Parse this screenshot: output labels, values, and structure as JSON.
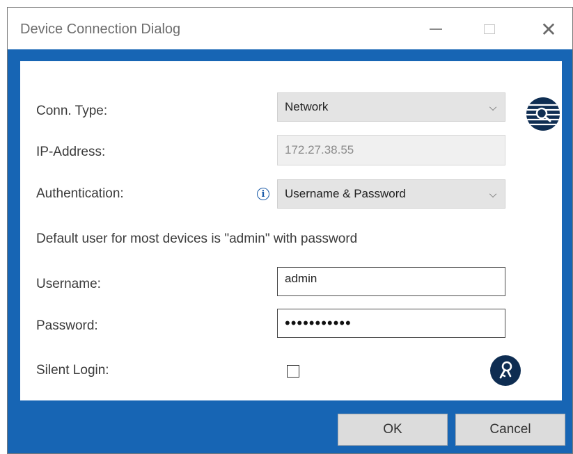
{
  "window": {
    "title": "Device Connection Dialog",
    "controls": {
      "close_glyph": "✕"
    }
  },
  "form": {
    "conn_type": {
      "label": "Conn. Type:",
      "value": "Network",
      "arrow": "⌵"
    },
    "ip_address": {
      "label": "IP-Address:",
      "value": "172.27.38.55"
    },
    "authentication": {
      "label": "Authentication:",
      "value": "Username & Password",
      "arrow": "⌵",
      "info_glyph": "i"
    },
    "note": "Default user for most devices is \"admin\" with password",
    "username": {
      "label": "Username:",
      "value": "admin"
    },
    "password": {
      "label": "Password:",
      "masked": "•••••••••••"
    },
    "silent_login": {
      "label": "Silent Login:",
      "checked": false
    }
  },
  "buttons": {
    "ok": "OK",
    "cancel": "Cancel"
  },
  "icons": {
    "scan": "network-scan-icon",
    "login": "key-login-icon",
    "info": "info-icon"
  },
  "colors": {
    "frame_blue": "#1765b4",
    "icon_navy": "#0e2d52"
  }
}
